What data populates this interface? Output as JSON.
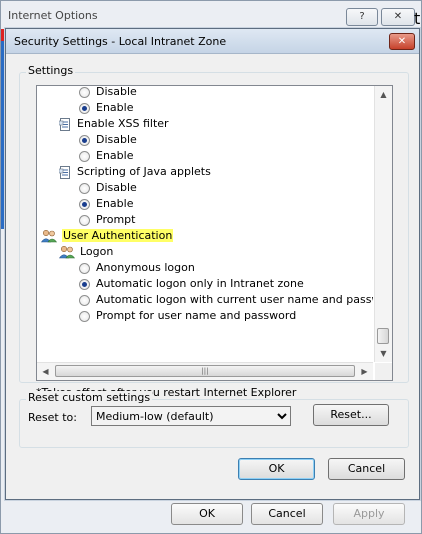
{
  "parent_window": {
    "title": "Internet Options",
    "help_button": "?",
    "close_button": "✕",
    "buttons": {
      "ok": "OK",
      "cancel": "Cancel",
      "apply": "Apply"
    },
    "side_fragment": "t"
  },
  "dialog": {
    "title": "Security Settings - Local Intranet Zone",
    "close_button": "✕",
    "settings_group_label": "Settings",
    "rows": [
      {
        "type": "radio",
        "label": "Disable",
        "checked": false
      },
      {
        "type": "radio",
        "label": "Enable",
        "checked": true
      },
      {
        "type": "category",
        "label": "Enable XSS filter",
        "icon": "settings-doc-icon"
      },
      {
        "type": "radio",
        "label": "Disable",
        "checked": true
      },
      {
        "type": "radio",
        "label": "Enable",
        "checked": false
      },
      {
        "type": "category",
        "label": "Scripting of Java applets",
        "icon": "settings-doc-icon"
      },
      {
        "type": "radio",
        "label": "Disable",
        "checked": false
      },
      {
        "type": "radio",
        "label": "Enable",
        "checked": true
      },
      {
        "type": "radio",
        "label": "Prompt",
        "checked": false
      },
      {
        "type": "section",
        "label": "User Authentication",
        "icon": "users-icon",
        "highlighted": true
      },
      {
        "type": "category",
        "label": "Logon",
        "icon": "users-icon"
      },
      {
        "type": "radio",
        "label": "Anonymous logon",
        "checked": false
      },
      {
        "type": "radio",
        "label": "Automatic logon only in Intranet zone",
        "checked": true
      },
      {
        "type": "radio",
        "label": "Automatic logon with current user name and password",
        "checked": false
      },
      {
        "type": "radio",
        "label": "Prompt for user name and password",
        "checked": false
      }
    ],
    "restart_note": "*Takes effect after you restart Internet Explorer",
    "reset_group_label": "Reset custom settings",
    "reset_to_label": "Reset to:",
    "reset_select": {
      "value": "Medium-low (default)",
      "options": [
        "Medium-low (default)"
      ]
    },
    "reset_button": "Reset...",
    "ok_button": "OK",
    "cancel_button": "Cancel"
  },
  "colors": {
    "highlight": "#ffff66",
    "titlebar": "#c5d4e6",
    "close_red": "#c6412b"
  }
}
